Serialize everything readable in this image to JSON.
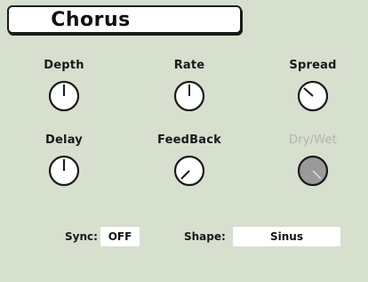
{
  "title": "Chorus",
  "knobs": {
    "depth": {
      "label": "Depth",
      "enabled": true
    },
    "rate": {
      "label": "Rate",
      "enabled": true
    },
    "spread": {
      "label": "Spread",
      "enabled": true
    },
    "delay": {
      "label": "Delay",
      "enabled": true
    },
    "feedback": {
      "label": "FeedBack",
      "enabled": true
    },
    "drywet": {
      "label": "Dry/Wet",
      "enabled": false
    }
  },
  "sync": {
    "label": "Sync:",
    "value": "OFF"
  },
  "shape": {
    "label": "Shape:",
    "value": "Sinus"
  },
  "colors": {
    "background": "#d7dfcf",
    "knob_fill": "#ffffff",
    "knob_disabled_fill": "#9a9a9a",
    "outline": "#1a1a1a",
    "disabled_text": "#b0b6ab"
  }
}
